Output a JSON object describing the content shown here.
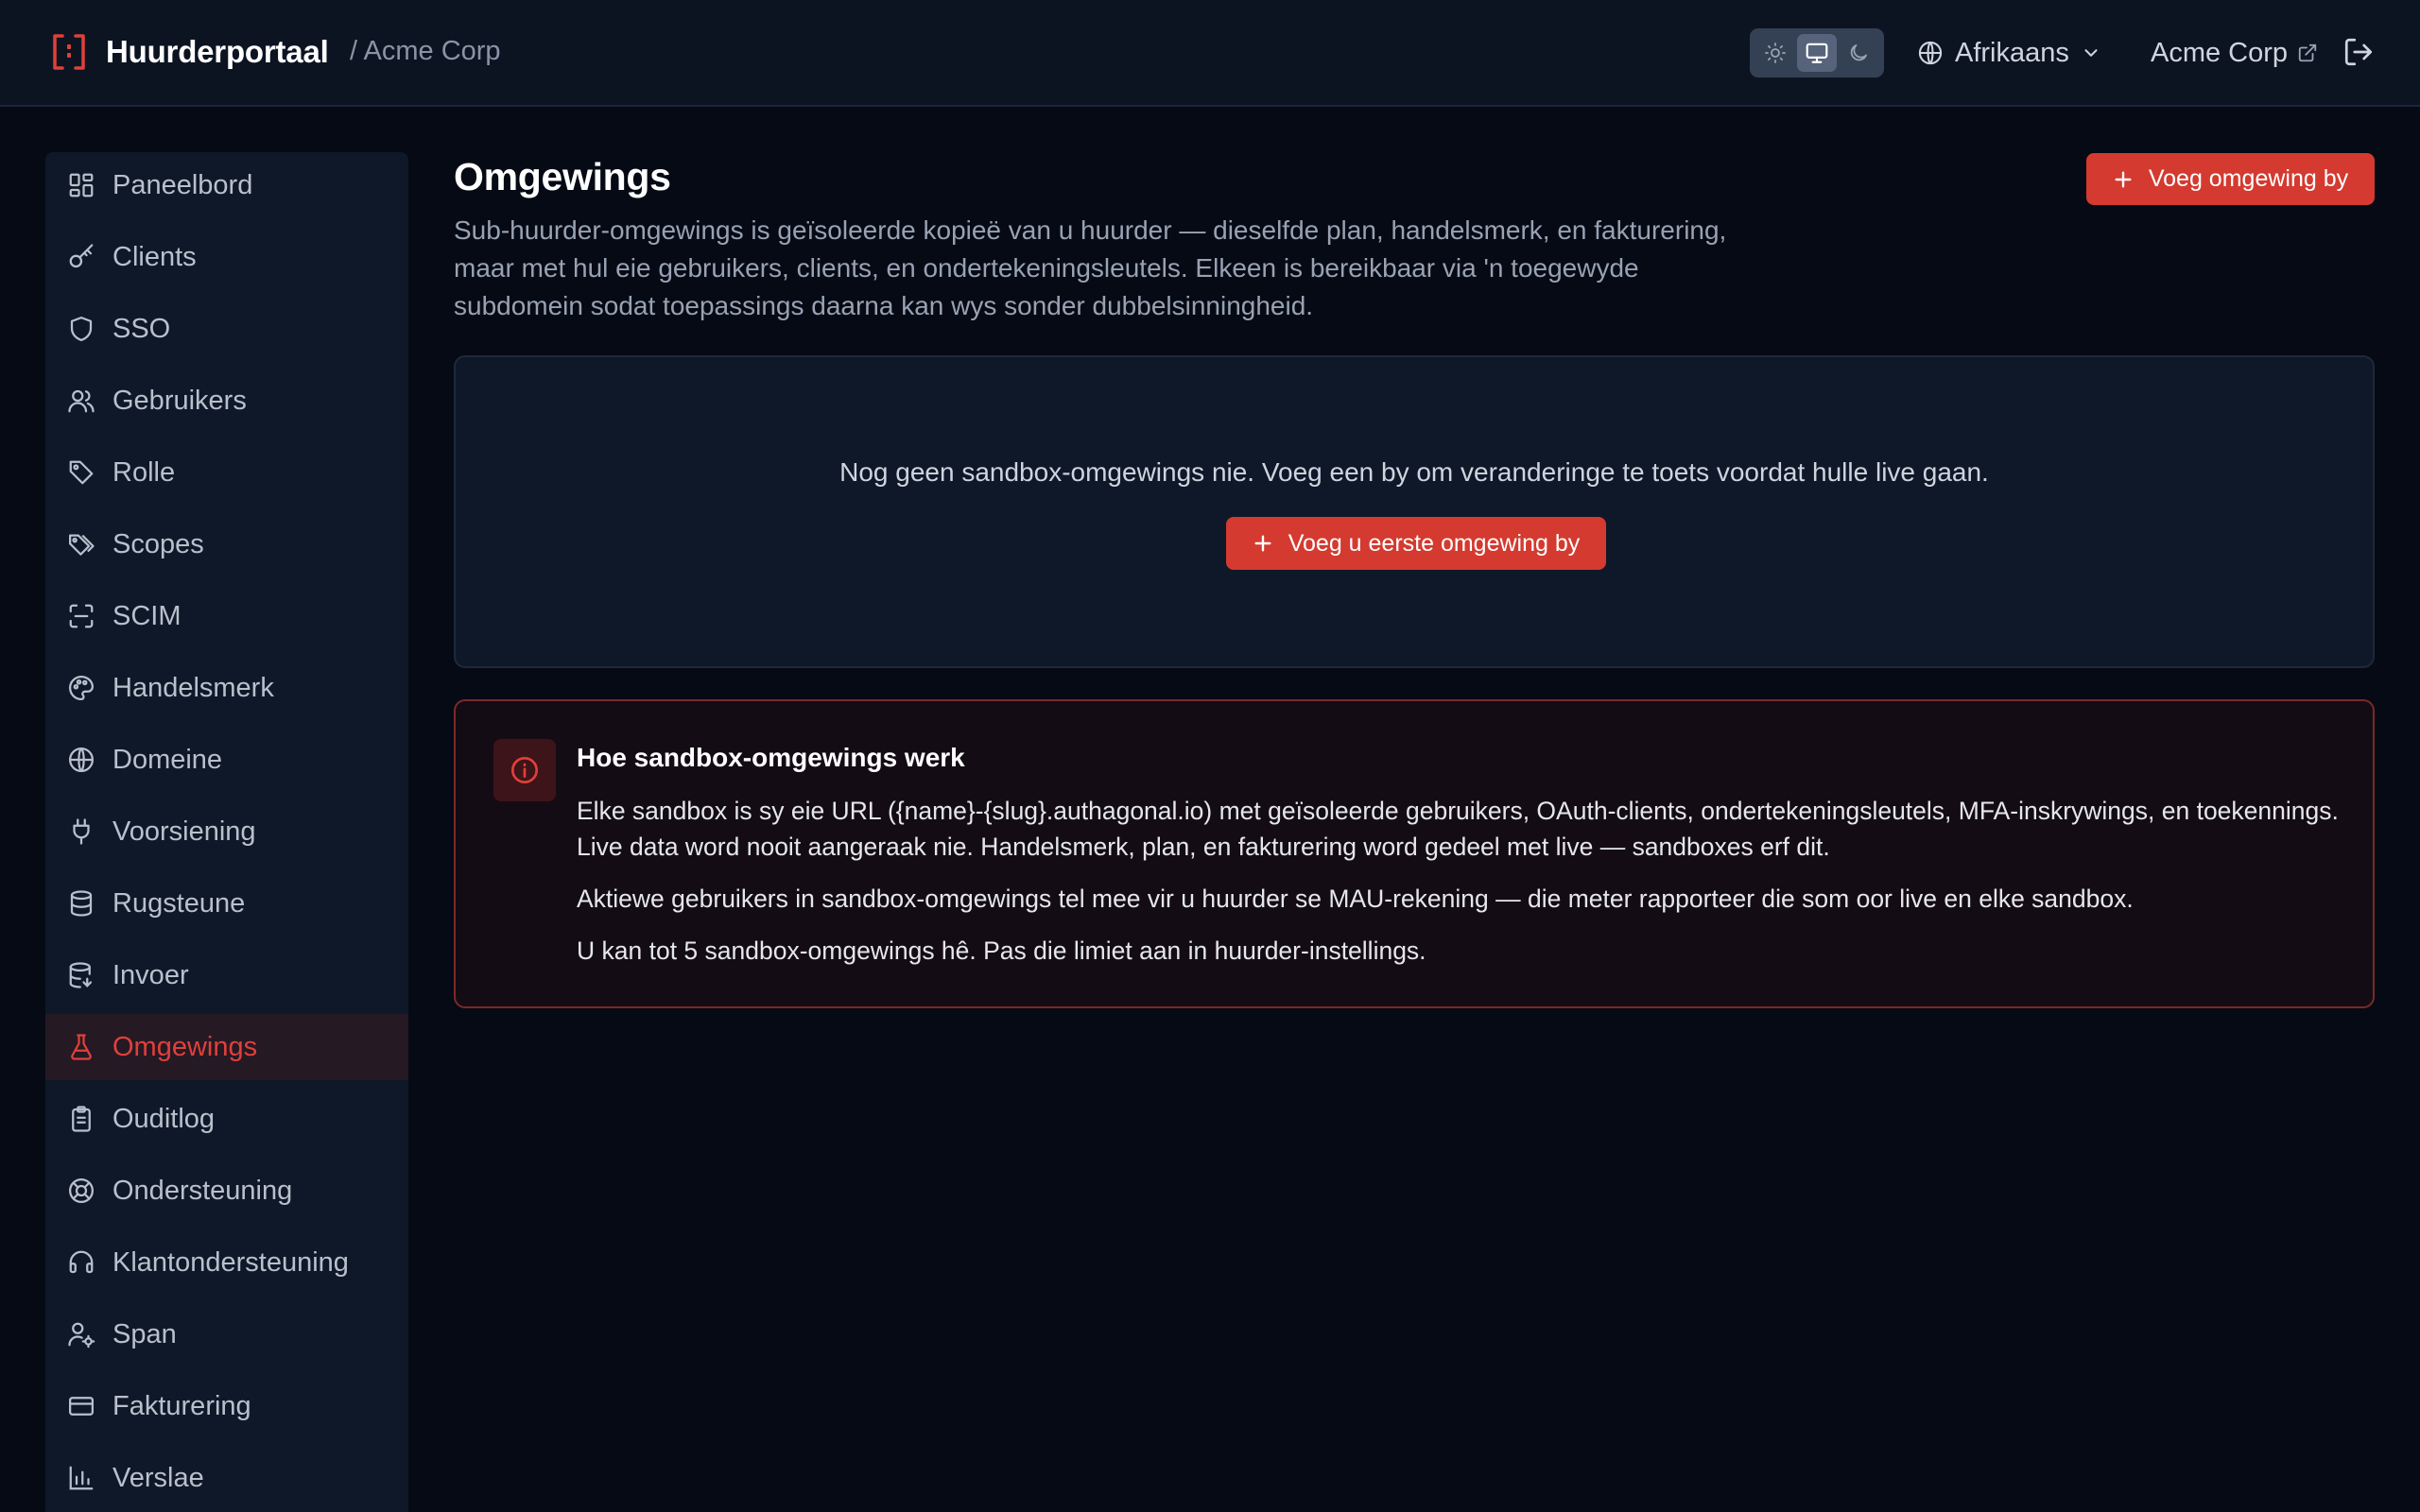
{
  "header": {
    "brand": "Huurderportaal",
    "breadcrumb": "/ Acme Corp",
    "theme_modes": [
      "light",
      "system",
      "dark"
    ],
    "active_theme": "system",
    "language": "Afrikaans",
    "tenant_link": "Acme Corp",
    "accent_color": "#d43a2f"
  },
  "sidebar": {
    "items": [
      {
        "label": "Paneelbord",
        "icon": "dashboard-icon"
      },
      {
        "label": "Clients",
        "icon": "key-icon"
      },
      {
        "label": "SSO",
        "icon": "shield-icon"
      },
      {
        "label": "Gebruikers",
        "icon": "users-icon"
      },
      {
        "label": "Rolle",
        "icon": "tag-icon"
      },
      {
        "label": "Scopes",
        "icon": "tags-icon"
      },
      {
        "label": "SCIM",
        "icon": "scan-icon"
      },
      {
        "label": "Handelsmerk",
        "icon": "palette-icon"
      },
      {
        "label": "Domeine",
        "icon": "globe-icon"
      },
      {
        "label": "Voorsiening",
        "icon": "plug-icon"
      },
      {
        "label": "Rugsteune",
        "icon": "database-icon"
      },
      {
        "label": "Invoer",
        "icon": "database-import-icon"
      },
      {
        "label": "Omgewings",
        "icon": "flask-icon",
        "active": true
      },
      {
        "label": "Ouditlog",
        "icon": "clipboard-icon"
      },
      {
        "label": "Ondersteuning",
        "icon": "lifebuoy-icon"
      },
      {
        "label": "Klantondersteuning",
        "icon": "headset-icon"
      },
      {
        "label": "Span",
        "icon": "user-cog-icon"
      },
      {
        "label": "Fakturering",
        "icon": "credit-card-icon"
      },
      {
        "label": "Verslae",
        "icon": "bar-chart-icon"
      }
    ]
  },
  "main": {
    "title": "Omgewings",
    "description": "Sub-huurder-omgewings is geïsoleerde kopieë van u huurder — dieselfde plan, handelsmerk, en fakturering, maar met hul eie gebruikers, clients, en ondertekeningsleutels. Elkeen is bereikbaar via 'n toegewyde subdomein sodat toepassings daarna kan wys sonder dubbelsinningheid.",
    "add_button": "Voeg omgewing by",
    "empty_state": {
      "message": "Nog geen sandbox-omgewings nie. Voeg een by om veranderinge te toets voordat hulle live gaan.",
      "button": "Voeg u eerste omgewing by"
    },
    "info": {
      "title": "Hoe sandbox-omgewings werk",
      "paragraphs": [
        "Elke sandbox is sy eie URL ({name}-{slug}.authagonal.io) met geïsoleerde gebruikers, OAuth-clients, ondertekeningsleutels, MFA-inskrywings, en toekennings. Live data word nooit aangeraak nie. Handelsmerk, plan, en fakturering word gedeel met live — sandboxes erf dit.",
        "Aktiewe gebruikers in sandbox-omgewings tel mee vir u huurder se MAU-rekening — die meter rapporteer die som oor live en elke sandbox.",
        "U kan tot 5 sandbox-omgewings hê. Pas die limiet aan in huurder-instellings."
      ]
    }
  }
}
